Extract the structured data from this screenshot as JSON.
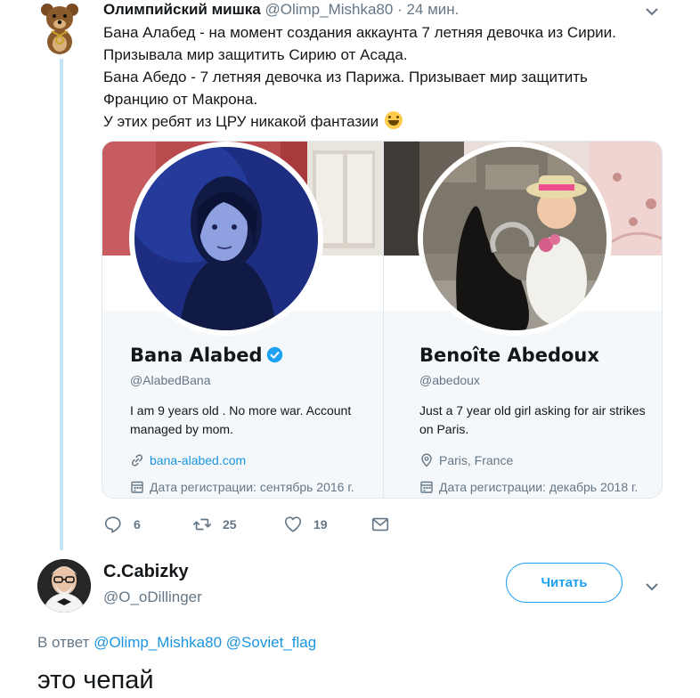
{
  "tweet": {
    "author_name": "Олимпийский мишка",
    "author_handle": "@Olimp_Mishka80",
    "time": "· 24 мин.",
    "lines": [
      "Бана Алабед - на момент создания аккаунта 7 летняя девочка из Сирии.",
      "Призывала мир защитить Сирию от Асада.",
      "Бана Абедо - 7 летняя девочка из Парижа. Призывает мир защитить",
      "Францию от Макрона.",
      "У этих ребят из ЦРУ никакой фантазии"
    ],
    "emoji": "grinning-face-with-smiling-eyes",
    "actions": {
      "reply_count": "6",
      "retweet_count": "25",
      "like_count": "19"
    }
  },
  "cards": [
    {
      "name": "Bana Alabed",
      "verified": true,
      "handle": "@AlabedBana",
      "bio": "I am 9 years old . No more war. Account managed by mom.",
      "link": "bana-alabed.com",
      "joined": "Дата регистрации: сентябрь 2016 г."
    },
    {
      "name": "Benoîte Abedoux",
      "verified": false,
      "handle": "@abedoux",
      "bio": "Just a 7 year old girl asking for air strikes on Paris.",
      "location": "Paris, France",
      "joined": "Дата регистрации: декабрь 2018 г."
    }
  ],
  "reply": {
    "author_name": "C.Cabizky",
    "author_handle": "@O_oDillinger",
    "follow_label": "Читать",
    "reply_to_prefix": "В ответ",
    "mention_1": "@Olimp_Mishka80",
    "mention_2": "@Soviet_flag",
    "text": "это чепай"
  },
  "colors": {
    "accent": "#1da1f2",
    "link": "#1b95e0",
    "muted": "#657786",
    "thread_line": "#c4e4f8"
  }
}
